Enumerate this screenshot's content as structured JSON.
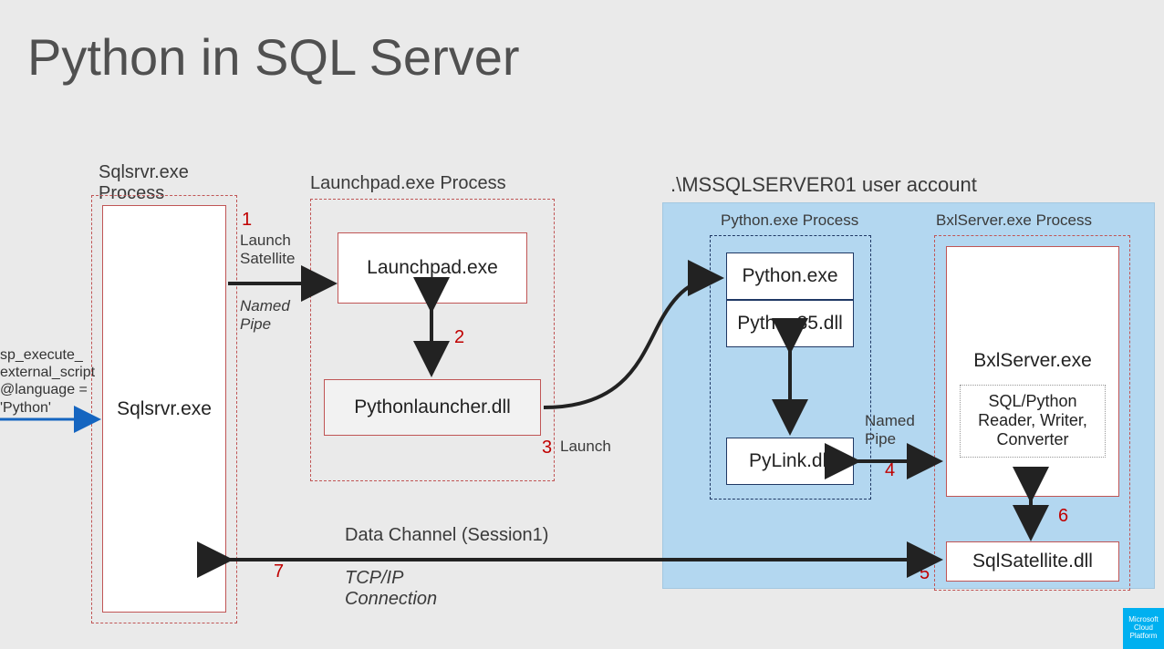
{
  "title": "Python in SQL Server",
  "script_call": "sp_execute_\nexternal_script\n@language =\n'Python'",
  "sqlsrvr_process": "Sqlsrvr.exe\nProcess",
  "sqlsrvr_box": "Sqlsrvr.exe",
  "launchpad_process": "Launchpad.exe  Process",
  "launchpad_box": "Launchpad.exe",
  "pythonlauncher_box": "Pythonlauncher.dll",
  "user_account": ".\\MSSQLSERVER01 user account",
  "python_process": "Python.exe Process",
  "python_exe": "Python.exe",
  "python35": "Python35.dll",
  "pylink": "PyLink.dll",
  "bxl_process": "BxlServer.exe Process",
  "bxlserver": "BxlServer.exe",
  "sqlpython": "SQL/Python\nReader, Writer,\nConverter",
  "sqlsatellite": "SqlSatellite.dll",
  "steps": {
    "n1": "1",
    "n2": "2",
    "n3": "3",
    "n4": "4",
    "n5": "5",
    "n6": "6",
    "n7": "7"
  },
  "labels": {
    "launch_satellite": "Launch\nSatellite",
    "named_pipe1": "Named\nPipe",
    "launch": "Launch",
    "named_pipe2": "Named\nPipe",
    "data_channel": "Data Channel (Session1)",
    "tcpip": "TCP/IP\nConnection"
  },
  "logo": "Microsoft Cloud Platform"
}
